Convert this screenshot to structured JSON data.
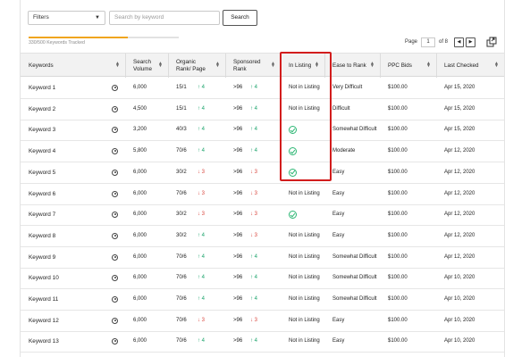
{
  "toolbar": {
    "filters_label": "Filters",
    "search_placeholder": "Search by keyword",
    "search_button": "Search"
  },
  "tracking": {
    "label": "330/500 Keywords Tracked",
    "progress_fraction": 0.66,
    "accent_color": "#f0a51e"
  },
  "pagination": {
    "page_label": "Page",
    "current_page": "1",
    "of_label": "of 8",
    "prev_icon": "chevron-left-icon",
    "next_icon": "chevron-right-icon",
    "export_icon": "export-icon"
  },
  "table": {
    "headers": [
      "Keywords",
      "Search Volume",
      "Organic Rank/ Page",
      "Sponsored Rank",
      "In Listing",
      "Ease to Rank",
      "PPC Bids",
      "Last Checked"
    ],
    "rows": [
      {
        "keyword": "Keyword 1",
        "volume": "6,000",
        "organic": "15/1",
        "org_dir": "up",
        "org_delta": "4",
        "sponsored": ">96",
        "sp_dir": "up",
        "sp_delta": "4",
        "in_listing": "Not in Listing",
        "ease": "Very Difficult",
        "ppc": "$100.00",
        "last": "Apr 15, 2020"
      },
      {
        "keyword": "Keyword 2",
        "volume": "4,500",
        "organic": "15/1",
        "org_dir": "up",
        "org_delta": "4",
        "sponsored": ">96",
        "sp_dir": "up",
        "sp_delta": "4",
        "in_listing": "Not in Listing",
        "ease": "Difficult",
        "ppc": "$100.00",
        "last": "Apr 15, 2020"
      },
      {
        "keyword": "Keyword 3",
        "volume": "3,200",
        "organic": "40/3",
        "org_dir": "up",
        "org_delta": "4",
        "sponsored": ">96",
        "sp_dir": "up",
        "sp_delta": "4",
        "in_listing": "check",
        "ease": "Somewhat Difficult",
        "ppc": "$100.00",
        "last": "Apr 15, 2020"
      },
      {
        "keyword": "Keyword 4",
        "volume": "5,800",
        "organic": "70/6",
        "org_dir": "up",
        "org_delta": "4",
        "sponsored": ">96",
        "sp_dir": "up",
        "sp_delta": "4",
        "in_listing": "check",
        "ease": "Moderate",
        "ppc": "$100.00",
        "last": "Apr 12, 2020"
      },
      {
        "keyword": "Keyword 5",
        "volume": "6,000",
        "organic": "30/2",
        "org_dir": "down",
        "org_delta": "3",
        "sponsored": ">96",
        "sp_dir": "down",
        "sp_delta": "3",
        "in_listing": "check",
        "ease": "Easy",
        "ppc": "$100.00",
        "last": "Apr 12, 2020"
      },
      {
        "keyword": "Keyword 6",
        "volume": "6,000",
        "organic": "70/6",
        "org_dir": "down",
        "org_delta": "3",
        "sponsored": ">96",
        "sp_dir": "down",
        "sp_delta": "3",
        "in_listing": "Not in Listing",
        "ease": "Easy",
        "ppc": "$100.00",
        "last": "Apr 12, 2020"
      },
      {
        "keyword": "Keyword 7",
        "volume": "6,000",
        "organic": "30/2",
        "org_dir": "down",
        "org_delta": "3",
        "sponsored": ">96",
        "sp_dir": "down",
        "sp_delta": "3",
        "in_listing": "check",
        "ease": "Easy",
        "ppc": "$100.00",
        "last": "Apr 12, 2020"
      },
      {
        "keyword": "Keyword 8",
        "volume": "6,000",
        "organic": "30/2",
        "org_dir": "up",
        "org_delta": "4",
        "sponsored": ">96",
        "sp_dir": "down",
        "sp_delta": "3",
        "in_listing": "Not in Listing",
        "ease": "Easy",
        "ppc": "$100.00",
        "last": "Apr 12, 2020"
      },
      {
        "keyword": "Keyword 9",
        "volume": "6,000",
        "organic": "70/6",
        "org_dir": "up",
        "org_delta": "4",
        "sponsored": ">96",
        "sp_dir": "up",
        "sp_delta": "4",
        "in_listing": "Not in Listing",
        "ease": "Somewhat Difficult",
        "ppc": "$100.00",
        "last": "Apr 12, 2020"
      },
      {
        "keyword": "Keyword 10",
        "volume": "6,000",
        "organic": "70/6",
        "org_dir": "up",
        "org_delta": "4",
        "sponsored": ">96",
        "sp_dir": "up",
        "sp_delta": "4",
        "in_listing": "Not in Listing",
        "ease": "Somewhat Difficult",
        "ppc": "$100.00",
        "last": "Apr 10, 2020"
      },
      {
        "keyword": "Keyword 11",
        "volume": "6,000",
        "organic": "70/6",
        "org_dir": "up",
        "org_delta": "4",
        "sponsored": ">96",
        "sp_dir": "up",
        "sp_delta": "4",
        "in_listing": "Not in Listing",
        "ease": "Somewhat Difficult",
        "ppc": "$100.00",
        "last": "Apr 10, 2020"
      },
      {
        "keyword": "Keyword 12",
        "volume": "6,000",
        "organic": "70/6",
        "org_dir": "down",
        "org_delta": "3",
        "sponsored": ">96",
        "sp_dir": "down",
        "sp_delta": "3",
        "in_listing": "Not in Listing",
        "ease": "Easy",
        "ppc": "$100.00",
        "last": "Apr 10, 2020"
      },
      {
        "keyword": "Keyword 13",
        "volume": "6,000",
        "organic": "70/6",
        "org_dir": "up",
        "org_delta": "4",
        "sponsored": ">96",
        "sp_dir": "up",
        "sp_delta": "4",
        "in_listing": "Not in Listing",
        "ease": "Easy",
        "ppc": "$100.00",
        "last": "Apr 10, 2020"
      }
    ]
  },
  "colors": {
    "up": "#1aa36b",
    "down": "#d9463e",
    "check": "#2bb673",
    "highlight": "#d21d1d"
  }
}
